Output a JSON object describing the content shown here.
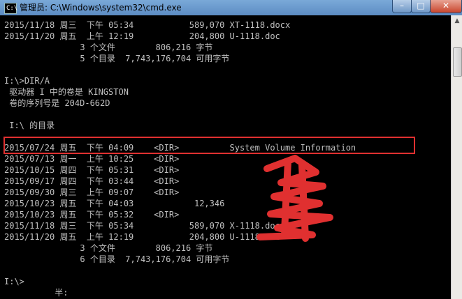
{
  "window": {
    "title": "管理员: C:\\Windows\\system32\\cmd.exe",
    "icon": "cmd-icon",
    "icon_glyph": "C:\\",
    "buttons": {
      "minimize": "–",
      "maximize": "□",
      "close": "✕"
    }
  },
  "console": {
    "lines": [
      "2015/11/18 周三  下午 05:34           589,070 XT-1118.docx",
      "2015/11/20 周五  上午 12:19           204,800 U-1118.doc",
      "               3 个文件        806,216 字节",
      "               5 个目录  7,743,176,704 可用字节",
      "",
      "I:\\>DIR/A",
      " 驱动器 I 中的卷是 KINGSTON",
      " 卷的序列号是 204D-662D",
      "",
      " I:\\ 的目录",
      "",
      "2015/07/24 周五  下午 04:09    <DIR>          System Volume Information",
      "2015/07/13 周一  上午 10:25    <DIR>",
      "2015/10/15 周四  下午 05:31    <DIR>",
      "2015/09/17 周四  下午 03:44    <DIR>",
      "2015/09/30 周三  上午 09:07    <DIR>",
      "2015/10/23 周五  下午 04:03            12,346",
      "2015/10/23 周五  下午 05:32    <DIR>",
      "2015/11/18 周三  下午 05:34           589,070 X-1118.docx",
      "2015/11/20 周五  上午 12:19           204,800 U-1118.doc",
      "               3 个文件        806,216 字节",
      "               6 个目录  7,743,176,704 可用字节",
      "",
      "I:\\>",
      "          半:"
    ]
  },
  "annotations": {
    "highlight_color": "#e03030",
    "scribble_color": "#e03030"
  }
}
